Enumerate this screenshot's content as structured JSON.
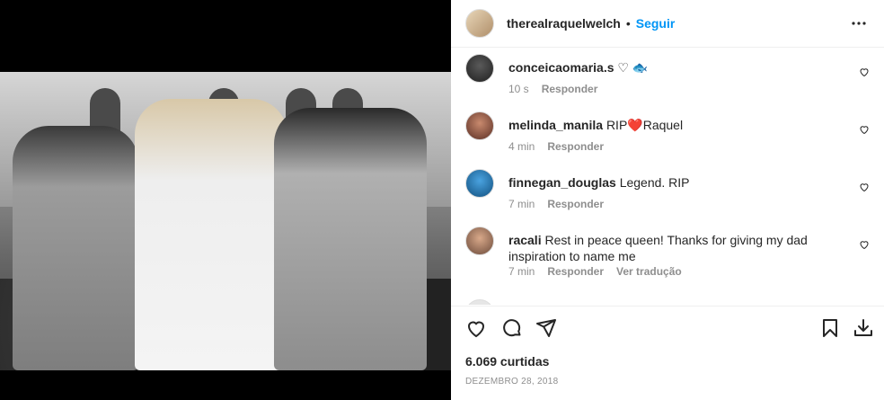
{
  "post": {
    "username": "therealraquelwelch",
    "dot": "•",
    "follow_label": "Seguir",
    "likes": "6.069 curtidas",
    "date": "DEZEMBRO 28, 2018"
  },
  "comments": [
    {
      "username": "conceicaomaria.s",
      "text": "♡ 🐟",
      "time": "10 s",
      "reply": "Responder",
      "translate": ""
    },
    {
      "username": "melinda_manila",
      "text": "RIP❤️Raquel",
      "time": "4 min",
      "reply": "Responder",
      "translate": ""
    },
    {
      "username": "finnegan_douglas",
      "text": "Legend. RIP",
      "time": "7 min",
      "reply": "Responder",
      "translate": ""
    },
    {
      "username": "racali",
      "text": "Rest in peace queen! Thanks for giving my dad inspiration to name me",
      "time": "7 min",
      "reply": "Responder",
      "translate": "Ver tradução"
    }
  ],
  "icons": {
    "more": "more-horizontal-icon",
    "like": "heart-icon",
    "comment": "comment-bubble-icon",
    "share": "paper-plane-icon",
    "save": "bookmark-icon",
    "download": "download-icon"
  },
  "colors": {
    "accent": "#0095f6",
    "meta": "#8e8e8e",
    "text": "#262626"
  }
}
